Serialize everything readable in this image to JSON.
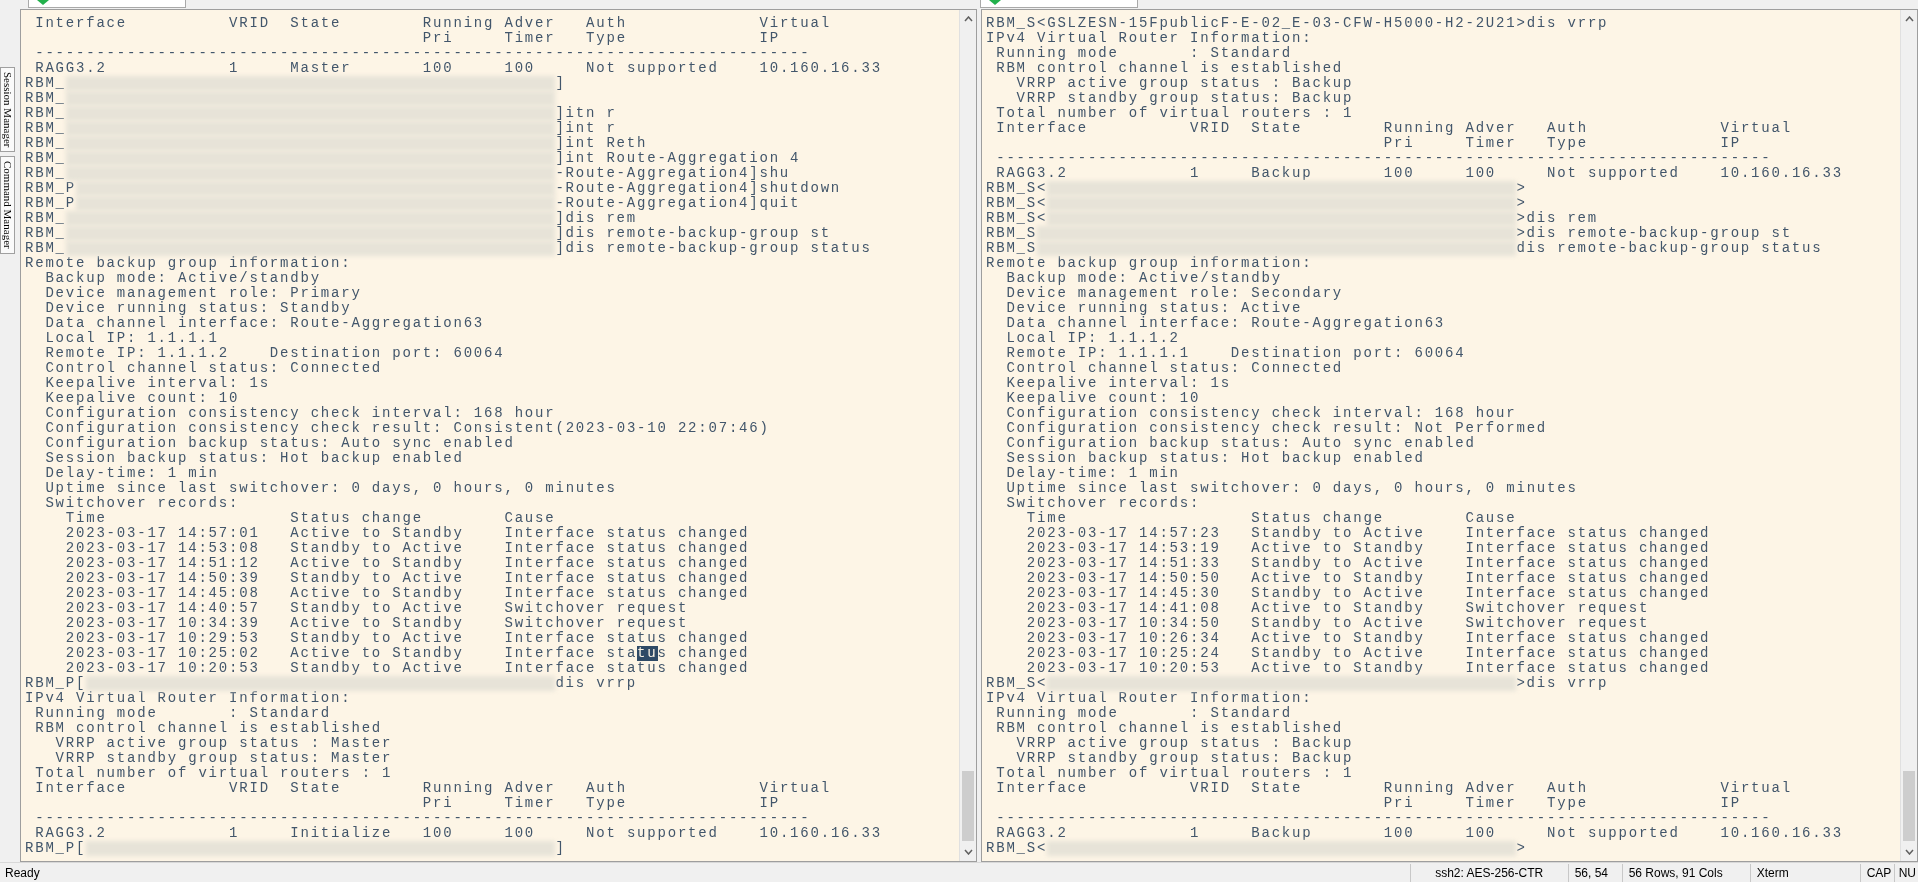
{
  "side_tabs": [
    {
      "label": "Session Manager"
    },
    {
      "label": "Command Manager"
    }
  ],
  "panes": [
    {
      "lines": [
        {
          "kind": "output",
          "text": " Interface          VRID  State        Running Adver   Auth             Virtual"
        },
        {
          "kind": "output",
          "text": "                                       Pri     Timer   Type             IP"
        },
        {
          "kind": "output",
          "text": " ----------------------------------------------------------------------------"
        },
        {
          "kind": "output",
          "text": " RAGG3.2            1     Master       100     100     Not supported    10.160.16.33"
        },
        {
          "kind": "masked",
          "prompt": "RBM_",
          "command": "]"
        },
        {
          "kind": "masked",
          "prompt": "RBM_"
        },
        {
          "kind": "masked",
          "prompt": "RBM_",
          "command": "]itn r"
        },
        {
          "kind": "masked",
          "prompt": "RBM_",
          "command": "]int r"
        },
        {
          "kind": "masked",
          "prompt": "RBM_",
          "command": "]int Reth"
        },
        {
          "kind": "masked",
          "prompt": "RBM_",
          "command": "]int Route-Aggregation 4"
        },
        {
          "kind": "masked",
          "prompt": "RBM_",
          "command": "-Route-Aggregation4]shu"
        },
        {
          "kind": "masked",
          "prompt": "RBM_P",
          "command": "-Route-Aggregation4]shutdown"
        },
        {
          "kind": "masked",
          "prompt": "RBM_P",
          "command": "-Route-Aggregation4]quit"
        },
        {
          "kind": "masked",
          "prompt": "RBM_",
          "command": "]dis rem"
        },
        {
          "kind": "masked",
          "prompt": "RBM_",
          "command": "]dis remote-backup-group st"
        },
        {
          "kind": "masked",
          "prompt": "RBM_",
          "command": "]dis remote-backup-group status"
        },
        {
          "kind": "output",
          "text": "Remote backup group information:"
        },
        {
          "kind": "output",
          "text": "  Backup mode: Active/standby"
        },
        {
          "kind": "output",
          "text": "  Device management role: Primary"
        },
        {
          "kind": "output",
          "text": "  Device running status: Standby"
        },
        {
          "kind": "output",
          "text": "  Data channel interface: Route-Aggregation63"
        },
        {
          "kind": "output",
          "text": "  Local IP: 1.1.1.1"
        },
        {
          "kind": "output",
          "text": "  Remote IP: 1.1.1.2    Destination port: 60064"
        },
        {
          "kind": "output",
          "text": "  Control channel status: Connected"
        },
        {
          "kind": "output",
          "text": "  Keepalive interval: 1s"
        },
        {
          "kind": "output",
          "text": "  Keepalive count: 10"
        },
        {
          "kind": "output",
          "text": "  Configuration consistency check interval: 168 hour"
        },
        {
          "kind": "output",
          "text": "  Configuration consistency check result: Consistent(2023-03-10 22:07:46)"
        },
        {
          "kind": "output",
          "text": "  Configuration backup status: Auto sync enabled"
        },
        {
          "kind": "output",
          "text": "  Session backup status: Hot backup enabled"
        },
        {
          "kind": "output",
          "text": "  Delay-time: 1 min"
        },
        {
          "kind": "output",
          "text": "  Uptime since last switchover: 0 days, 0 hours, 0 minutes"
        },
        {
          "kind": "output",
          "text": "  Switchover records:"
        },
        {
          "kind": "output",
          "text": "    Time                  Status change        Cause"
        },
        {
          "kind": "output",
          "text": "    2023-03-17 14:57:01   Active to Standby    Interface status changed"
        },
        {
          "kind": "output",
          "text": "    2023-03-17 14:53:08   Standby to Active    Interface status changed"
        },
        {
          "kind": "output",
          "text": "    2023-03-17 14:51:12   Active to Standby    Interface status changed"
        },
        {
          "kind": "output",
          "text": "    2023-03-17 14:50:39   Standby to Active    Interface status changed"
        },
        {
          "kind": "output",
          "text": "    2023-03-17 14:45:08   Active to Standby    Interface status changed"
        },
        {
          "kind": "output",
          "text": "    2023-03-17 14:40:57   Standby to Active    Switchover request"
        },
        {
          "kind": "output",
          "text": "    2023-03-17 10:34:39   Active to Standby    Switchover request"
        },
        {
          "kind": "output",
          "text": "    2023-03-17 10:29:53   Standby to Active    Interface status changed"
        },
        {
          "kind": "selection",
          "segments": [
            {
              "text": "    2023-03-17 10:25:02   Active to Standby    Interface sta",
              "selected": false
            },
            {
              "text": "tu",
              "selected": true
            },
            {
              "text": "s changed",
              "selected": false
            }
          ]
        },
        {
          "kind": "output",
          "text": "    2023-03-17 10:20:53   Standby to Active    Interface status changed"
        },
        {
          "kind": "masked",
          "prompt": "RBM_P[",
          "command": "dis vrrp"
        },
        {
          "kind": "output",
          "text": "IPv4 Virtual Router Information:"
        },
        {
          "kind": "output",
          "text": " Running mode       : Standard"
        },
        {
          "kind": "output",
          "text": " RBM control channel is established"
        },
        {
          "kind": "output",
          "text": "   VRRP active group status : Master"
        },
        {
          "kind": "output",
          "text": "   VRRP standby group status: Master"
        },
        {
          "kind": "output",
          "text": " Total number of virtual routers : 1"
        },
        {
          "kind": "output",
          "text": " Interface          VRID  State        Running Adver   Auth             Virtual"
        },
        {
          "kind": "output",
          "text": "                                       Pri     Timer   Type             IP"
        },
        {
          "kind": "output",
          "text": " ----------------------------------------------------------------------------"
        },
        {
          "kind": "output",
          "text": " RAGG3.2            1     Initialize   100     100     Not supported    10.160.16.33"
        },
        {
          "kind": "masked",
          "prompt": "RBM_P[",
          "command": "]"
        }
      ]
    },
    {
      "lines": [
        {
          "kind": "output",
          "text": "RBM_S<GSLZESN-15FpublicF-E-02_E-03-CFW-H5000-H2-2U21>dis vrrp"
        },
        {
          "kind": "output",
          "text": "IPv4 Virtual Router Information:"
        },
        {
          "kind": "output",
          "text": " Running mode       : Standard"
        },
        {
          "kind": "output",
          "text": " RBM control channel is established"
        },
        {
          "kind": "output",
          "text": "   VRRP active group status : Backup"
        },
        {
          "kind": "output",
          "text": "   VRRP standby group status: Backup"
        },
        {
          "kind": "output",
          "text": " Total number of virtual routers : 1"
        },
        {
          "kind": "output",
          "text": " Interface          VRID  State        Running Adver   Auth             Virtual"
        },
        {
          "kind": "output",
          "text": "                                       Pri     Timer   Type             IP"
        },
        {
          "kind": "output",
          "text": " ----------------------------------------------------------------------------"
        },
        {
          "kind": "output",
          "text": " RAGG3.2            1     Backup       100     100     Not supported    10.160.16.33"
        },
        {
          "kind": "masked",
          "prompt": "RBM_S<",
          "command": ">"
        },
        {
          "kind": "masked",
          "prompt": "RBM_S<",
          "command": ">"
        },
        {
          "kind": "masked",
          "prompt": "RBM_S<",
          "command": ">dis rem"
        },
        {
          "kind": "masked",
          "prompt": "RBM_S",
          "command": ">dis remote-backup-group st"
        },
        {
          "kind": "masked",
          "prompt": "RBM_S",
          "command": "dis remote-backup-group status"
        },
        {
          "kind": "output",
          "text": "Remote backup group information:"
        },
        {
          "kind": "output",
          "text": "  Backup mode: Active/standby"
        },
        {
          "kind": "output",
          "text": "  Device management role: Secondary"
        },
        {
          "kind": "output",
          "text": "  Device running status: Active"
        },
        {
          "kind": "output",
          "text": "  Data channel interface: Route-Aggregation63"
        },
        {
          "kind": "output",
          "text": "  Local IP: 1.1.1.2"
        },
        {
          "kind": "output",
          "text": "  Remote IP: 1.1.1.1    Destination port: 60064"
        },
        {
          "kind": "output",
          "text": "  Control channel status: Connected"
        },
        {
          "kind": "output",
          "text": "  Keepalive interval: 1s"
        },
        {
          "kind": "output",
          "text": "  Keepalive count: 10"
        },
        {
          "kind": "output",
          "text": "  Configuration consistency check interval: 168 hour"
        },
        {
          "kind": "output",
          "text": "  Configuration consistency check result: Not Performed"
        },
        {
          "kind": "output",
          "text": "  Configuration backup status: Auto sync enabled"
        },
        {
          "kind": "output",
          "text": "  Session backup status: Hot backup enabled"
        },
        {
          "kind": "output",
          "text": "  Delay-time: 1 min"
        },
        {
          "kind": "output",
          "text": "  Uptime since last switchover: 0 days, 0 hours, 0 minutes"
        },
        {
          "kind": "output",
          "text": "  Switchover records:"
        },
        {
          "kind": "output",
          "text": "    Time                  Status change        Cause"
        },
        {
          "kind": "output",
          "text": "    2023-03-17 14:57:23   Standby to Active    Interface status changed"
        },
        {
          "kind": "output",
          "text": "    2023-03-17 14:53:19   Active to Standby    Interface status changed"
        },
        {
          "kind": "output",
          "text": "    2023-03-17 14:51:33   Standby to Active    Interface status changed"
        },
        {
          "kind": "output",
          "text": "    2023-03-17 14:50:50   Active to Standby    Interface status changed"
        },
        {
          "kind": "output",
          "text": "    2023-03-17 14:45:30   Standby to Active    Interface status changed"
        },
        {
          "kind": "output",
          "text": "    2023-03-17 14:41:08   Active to Standby    Switchover request"
        },
        {
          "kind": "output",
          "text": "    2023-03-17 10:34:50   Standby to Active    Switchover request"
        },
        {
          "kind": "output",
          "text": "    2023-03-17 10:26:34   Active to Standby    Interface status changed"
        },
        {
          "kind": "output",
          "text": "    2023-03-17 10:25:24   Standby to Active    Interface status changed"
        },
        {
          "kind": "output",
          "text": "    2023-03-17 10:20:53   Active to Standby    Interface status changed"
        },
        {
          "kind": "masked",
          "prompt": "RBM_S<",
          "command": ">dis vrrp"
        },
        {
          "kind": "output",
          "text": "IPv4 Virtual Router Information:"
        },
        {
          "kind": "output",
          "text": " Running mode       : Standard"
        },
        {
          "kind": "output",
          "text": " RBM control channel is established"
        },
        {
          "kind": "output",
          "text": "   VRRP active group status : Backup"
        },
        {
          "kind": "output",
          "text": "   VRRP standby group status: Backup"
        },
        {
          "kind": "output",
          "text": " Total number of virtual routers : 1"
        },
        {
          "kind": "output",
          "text": " Interface          VRID  State        Running Adver   Auth             Virtual"
        },
        {
          "kind": "output",
          "text": "                                       Pri     Timer   Type             IP"
        },
        {
          "kind": "output",
          "text": " ----------------------------------------------------------------------------"
        },
        {
          "kind": "output",
          "text": " RAGG3.2            1     Backup       100     100     Not supported    10.160.16.33"
        },
        {
          "kind": "masked",
          "prompt": "RBM_S<",
          "command": ">"
        }
      ]
    }
  ],
  "status_bar": {
    "message": "Ready",
    "fields": [
      "ssh2: AES-256-CTR",
      "56, 54",
      "56 Rows, 91 Cols",
      "Xterm",
      "CAP",
      "NU"
    ]
  }
}
